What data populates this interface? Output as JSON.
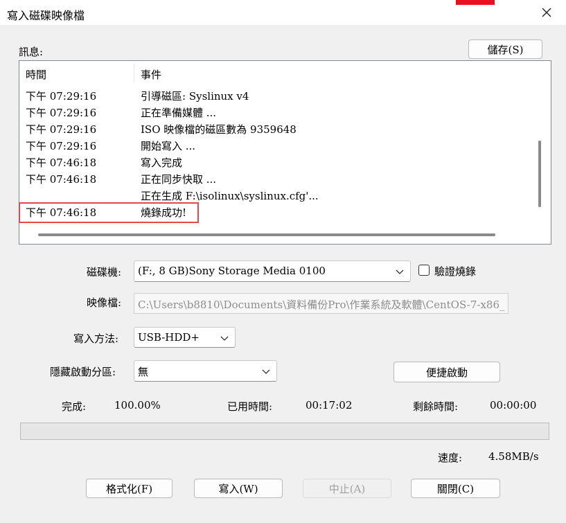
{
  "window": {
    "title": "寫入磁碟映像檔"
  },
  "log": {
    "label": "訊息:",
    "save_button": "儲存(S)",
    "columns": {
      "time": "時間",
      "event": "事件"
    },
    "rows": [
      {
        "time": "下午 07:29:16",
        "event": "引導磁區: Syslinux v4"
      },
      {
        "time": "下午 07:29:16",
        "event": "正在準備媒體 ..."
      },
      {
        "time": "下午 07:29:16",
        "event": "ISO 映像檔的磁區數為 9359648"
      },
      {
        "time": "下午 07:29:16",
        "event": "開始寫入 ..."
      },
      {
        "time": "下午 07:46:18",
        "event": "寫入完成"
      },
      {
        "time": "下午 07:46:18",
        "event": "正在同步快取 ..."
      },
      {
        "time": "",
        "event": "正在生成 F:\\isolinux\\syslinux.cfg'..."
      },
      {
        "time": "下午 07:46:18",
        "event": "燒錄成功!"
      }
    ]
  },
  "form": {
    "drive": {
      "label": "磁碟機:",
      "value": "(F:, 8 GB)Sony    Storage Media   0100"
    },
    "verify": {
      "label": "驗證燒錄",
      "checked": false
    },
    "image": {
      "label": "映像檔:",
      "value": "C:\\Users\\b8810\\Documents\\資料備份Pro\\作業系統及軟體\\CentOS-7-x86_"
    },
    "write_method": {
      "label": "寫入方法:",
      "value": "USB-HDD+"
    },
    "hidden_partition": {
      "label": "隱藏啟動分區:",
      "value": "無"
    },
    "quick_boot_button": "便捷啟動"
  },
  "status": {
    "done_label": "完成:",
    "done_value": "100.00%",
    "elapsed_label": "已用時間:",
    "elapsed_value": "00:17:02",
    "remaining_label": "剩餘時間:",
    "remaining_value": "00:00:00",
    "speed_label": "速度:",
    "speed_value": "4.58MB/s",
    "progress": 1.0
  },
  "buttons": {
    "format": "格式化(F)",
    "write": "寫入(W)",
    "abort": "中止(A)",
    "close": "關閉(C)"
  },
  "icons": {
    "close": "close-icon",
    "dropdown": "chevron-down-icon"
  },
  "colors": {
    "highlight": "#e14a4a",
    "titlebar_accent": "#e81123"
  }
}
